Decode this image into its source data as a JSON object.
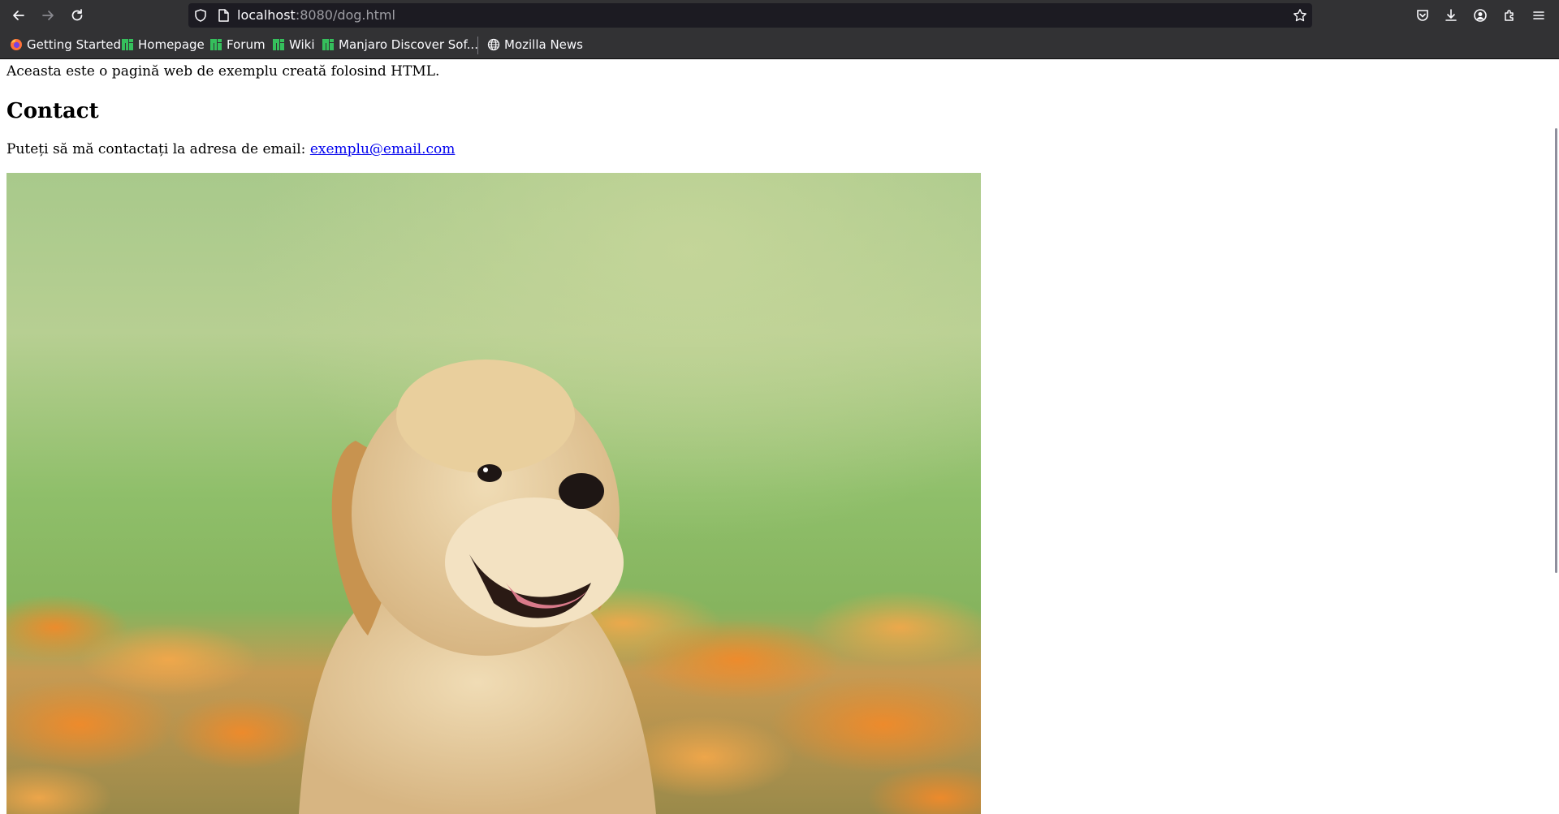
{
  "browser": {
    "url_host": "localhost",
    "url_path": ":8080/dog.html",
    "nav_icons": [
      "back-arrow-icon",
      "forward-arrow-icon",
      "reload-icon"
    ],
    "right_icons": [
      "pocket-icon",
      "downloads-icon",
      "account-icon",
      "extensions-icon",
      "menu-icon"
    ],
    "bookmarks": [
      {
        "label": "Getting Started",
        "icon": "firefox-icon"
      },
      {
        "label": "Homepage",
        "icon": "manjaro-icon"
      },
      {
        "label": "Forum",
        "icon": "manjaro-icon"
      },
      {
        "label": "Wiki",
        "icon": "manjaro-icon"
      },
      {
        "label": "Manjaro Discover Sof...",
        "icon": "manjaro-icon"
      },
      {
        "label": "Mozilla News",
        "icon": "globe-icon"
      }
    ]
  },
  "page": {
    "intro": "Aceasta este o pagină web de exemplu creată folosind HTML.",
    "contact_heading": "Contact",
    "contact_text": "Puteți să mă contactați la adresa de email: ",
    "email_link": "exemplu@email.com",
    "image_subject": "golden-retriever-puppy-image"
  },
  "colors": {
    "toolbar": "#323234",
    "urlbar": "#1c1b22",
    "link": "#0000ee",
    "manjaro_green": "#35bf5c"
  }
}
